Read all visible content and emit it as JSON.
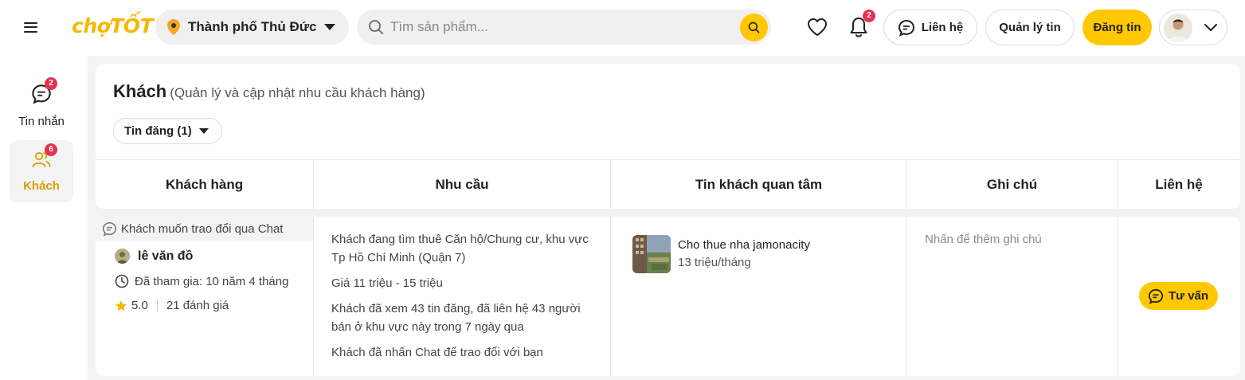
{
  "header": {
    "logo": {
      "part1": "chợ",
      "part2": "TỐT"
    },
    "location": "Thành phố Thủ Đức",
    "search_placeholder": "Tìm sản phẩm...",
    "notification_count": "2",
    "contact_label": "Liên hệ",
    "manage_label": "Quản lý tin",
    "post_label": "Đăng tin"
  },
  "sidebar": {
    "items": [
      {
        "label": "Tin nhắn",
        "badge": "2"
      },
      {
        "label": "Khách",
        "badge": "6"
      }
    ]
  },
  "main": {
    "title": "Khách",
    "subtitle": "(Quản lý và cập nhật nhu cầu khách hàng)",
    "filter_label": "Tin đăng (1)",
    "columns": [
      "Khách hàng",
      "Nhu cầu",
      "Tin khách quan tâm",
      "Ghi chú",
      "Liên hệ"
    ]
  },
  "rows": [
    {
      "chat_banner": "Khách muốn trao đổi qua Chat",
      "customer_name": "lê văn đồ",
      "joined": "Đã tham gia: 10 năm 4 tháng",
      "rating": "5.0",
      "reviews": "21 đánh giá",
      "needs": [
        "Khách đang tìm thuê Căn hộ/Chung cư, khu vực Tp Hồ Chí Minh (Quận 7)",
        "Giá 11 triệu - 15 triệu",
        "Khách đã xem 43 tin đăng, đã liên hệ 43 người bán ở khu vực này trong 7 ngày qua",
        "Khách đã nhấn Chat để trao đổi với bạn"
      ],
      "listing_title": "Cho thue nha jamonacity",
      "listing_price": "13 triệu/tháng",
      "note_placeholder": "Nhấn để thêm ghi chú",
      "action_label": "Tư vấn"
    }
  ],
  "colors": {
    "brand_yellow": "#ffc800",
    "badge_red": "#e6324f",
    "active_text": "#d6a000"
  }
}
